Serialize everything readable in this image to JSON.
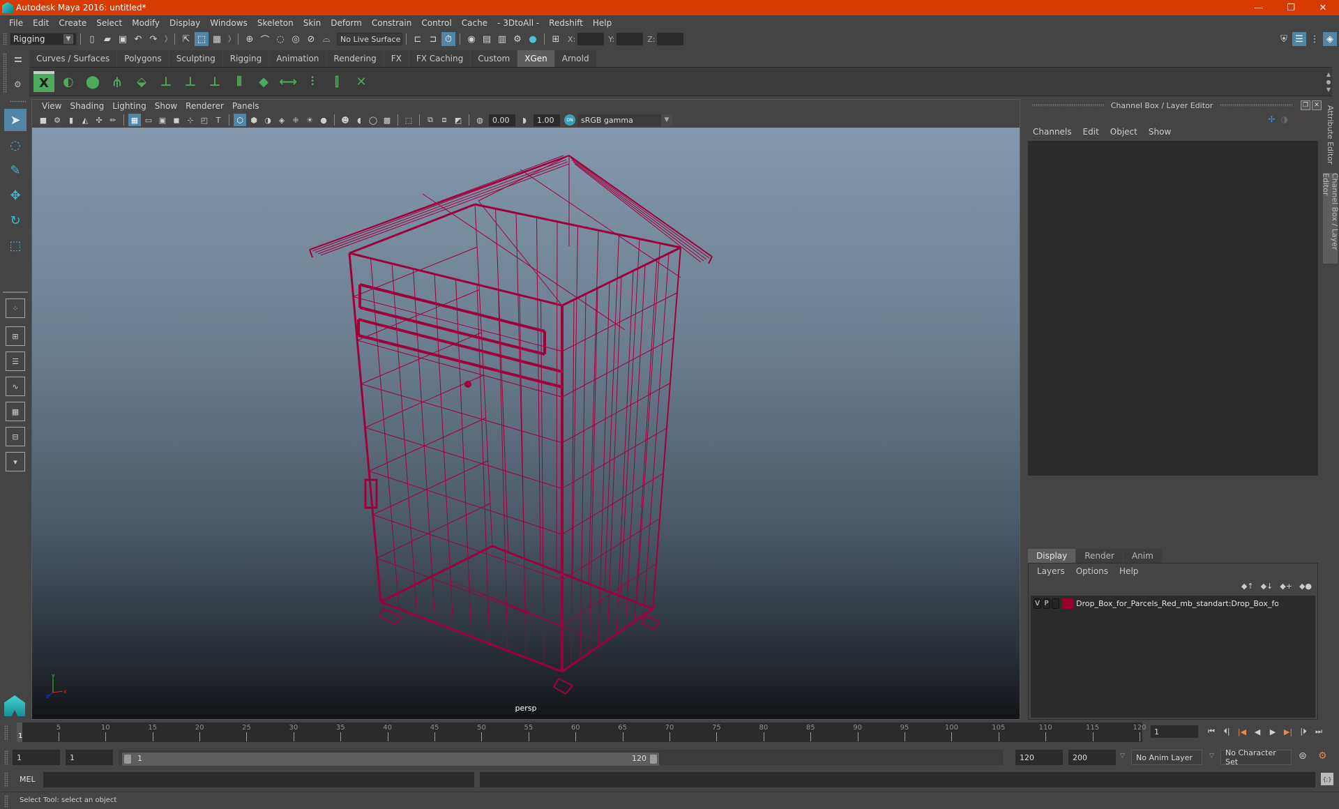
{
  "window": {
    "title": "Autodesk Maya 2016: untitled*",
    "controls": {
      "minimize": "—",
      "restore": "❐",
      "close": "✕"
    }
  },
  "menubar": [
    "File",
    "Edit",
    "Create",
    "Select",
    "Modify",
    "Display",
    "Windows",
    "Skeleton",
    "Skin",
    "Deform",
    "Constrain",
    "Control",
    "Cache",
    "- 3DtoAll -",
    "Redshift",
    "Help"
  ],
  "statusline": {
    "mode": "Rigging",
    "live_surface": "No Live Surface",
    "x_label": "X:",
    "y_label": "Y:",
    "z_label": "Z:",
    "x_value": "",
    "y_value": "",
    "z_value": ""
  },
  "shelf": {
    "tabs": [
      "Curves / Surfaces",
      "Polygons",
      "Sculpting",
      "Rigging",
      "Animation",
      "Rendering",
      "FX",
      "FX Caching",
      "Custom",
      "XGen",
      "Arnold"
    ],
    "active_tab": "XGen",
    "icons": [
      "xgen-editor",
      "xgen-guide-visibility",
      "xgen-primitive-toggle",
      "xgen-add-guide",
      "xgen-sculpt-guide",
      "xgen-add-guide-point",
      "xgen-guide-lock-view",
      "xgen-guide-lock",
      "xgen-guide-normalize",
      "xgen-spline-grid",
      "xgen-guide-length",
      "xgen-select-guide",
      "xgen-guide-bound",
      "xgen-delete-guide"
    ]
  },
  "viewport": {
    "menu": [
      "View",
      "Shading",
      "Lighting",
      "Show",
      "Renderer",
      "Panels"
    ],
    "exposure": "0.00",
    "gamma": "1.00",
    "color_management": "ON",
    "color_space": "sRGB gamma",
    "camera": "persp",
    "axis": {
      "x": "x",
      "y": "y",
      "z": "z"
    },
    "wire_color": "#a0003a"
  },
  "channel_box": {
    "title": "Channel Box / Layer Editor",
    "menu": [
      "Channels",
      "Edit",
      "Object",
      "Show"
    ]
  },
  "layer_editor": {
    "tabs": [
      "Display",
      "Render",
      "Anim"
    ],
    "active_tab": "Display",
    "menu": [
      "Layers",
      "Options",
      "Help"
    ],
    "layers": [
      {
        "visible": "V",
        "playback": "P",
        "ref": "",
        "color": "#99002a",
        "name": "Drop_Box_for_Parcels_Red_mb_standart:Drop_Box_for_Pa"
      }
    ]
  },
  "side_tabs": [
    "Attribute Editor",
    "Channel Box / Layer Editor"
  ],
  "active_side_tab": "Channel Box / Layer Editor",
  "timeline": {
    "start": 1,
    "end": 120,
    "ticks": [
      5,
      10,
      15,
      20,
      25,
      30,
      35,
      40,
      45,
      50,
      55,
      60,
      65,
      70,
      75,
      80,
      85,
      90,
      95,
      100,
      105,
      110,
      115,
      120
    ],
    "current_frame_marker": "1",
    "current_frame": "1"
  },
  "range": {
    "start_time": "1",
    "playback_start": "1",
    "slider_start": "1",
    "slider_end": "120",
    "playback_end": "120",
    "end_time": "200",
    "anim_layer": "No Anim Layer",
    "character_set": "No Character Set"
  },
  "command_line": {
    "label": "MEL",
    "input": "",
    "output": ""
  },
  "help_line": "Select Tool: select an object"
}
